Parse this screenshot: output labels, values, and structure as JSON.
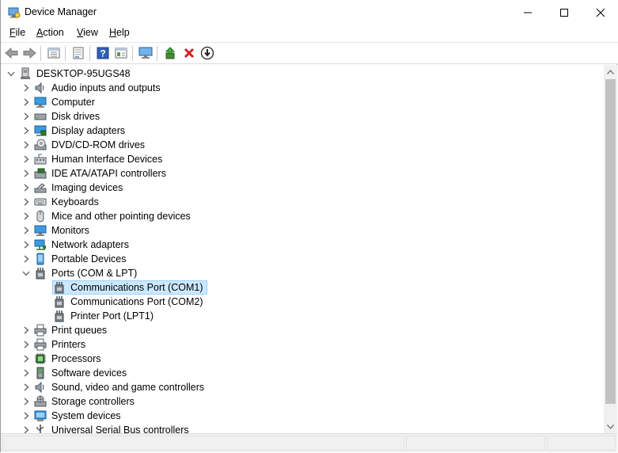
{
  "window": {
    "title": "Device Manager"
  },
  "titlebar": {
    "minimize": "—",
    "maximize": "☐",
    "close": "✕"
  },
  "menu": [
    {
      "label": "File",
      "key": "F",
      "rest": "ile"
    },
    {
      "label": "Action",
      "key": "A",
      "rest": "ction"
    },
    {
      "label": "View",
      "key": "V",
      "rest": "iew"
    },
    {
      "label": "Help",
      "key": "H",
      "rest": "elp"
    }
  ],
  "toolbar": [
    "back-icon",
    "forward-icon",
    "properties-view-icon",
    "show-hidden-icon",
    "help-icon",
    "action-view-icon",
    "monitor-icon",
    "update-driver-icon",
    "uninstall-icon",
    "download-icon"
  ],
  "tree": {
    "root": "DESKTOP-95UGS48",
    "categories": [
      {
        "label": "Audio inputs and outputs",
        "icon": "speaker-icon"
      },
      {
        "label": "Computer",
        "icon": "computer-icon"
      },
      {
        "label": "Disk drives",
        "icon": "disk-drive-icon"
      },
      {
        "label": "Display adapters",
        "icon": "display-adapter-icon"
      },
      {
        "label": "DVD/CD-ROM drives",
        "icon": "dvd-drive-icon"
      },
      {
        "label": "Human Interface Devices",
        "icon": "hid-icon"
      },
      {
        "label": "IDE ATA/ATAPI controllers",
        "icon": "ide-controller-icon"
      },
      {
        "label": "Imaging devices",
        "icon": "camera-icon"
      },
      {
        "label": "Keyboards",
        "icon": "keyboard-icon"
      },
      {
        "label": "Mice and other pointing devices",
        "icon": "mouse-icon"
      },
      {
        "label": "Monitors",
        "icon": "monitor-icon"
      },
      {
        "label": "Network adapters",
        "icon": "network-icon"
      },
      {
        "label": "Portable Devices",
        "icon": "portable-device-icon"
      },
      {
        "label": "Ports (COM & LPT)",
        "icon": "port-icon",
        "expanded": true,
        "children": [
          {
            "label": "Communications Port (COM1)",
            "selected": true
          },
          {
            "label": "Communications Port (COM2)"
          },
          {
            "label": "Printer Port (LPT1)"
          }
        ]
      },
      {
        "label": "Print queues",
        "icon": "printer-icon"
      },
      {
        "label": "Printers",
        "icon": "printer-icon"
      },
      {
        "label": "Processors",
        "icon": "processor-icon"
      },
      {
        "label": "Software devices",
        "icon": "software-device-icon"
      },
      {
        "label": "Sound, video and game controllers",
        "icon": "speaker-icon"
      },
      {
        "label": "Storage controllers",
        "icon": "storage-controller-icon"
      },
      {
        "label": "System devices",
        "icon": "system-device-icon"
      },
      {
        "label": "Universal Serial Bus controllers",
        "icon": "usb-icon"
      }
    ]
  },
  "colors": {
    "selection_bg": "#cce8ff",
    "selection_border": "#99d1ff",
    "accent_blue": "#2b6cc4",
    "delete_red": "#d61f1f"
  }
}
